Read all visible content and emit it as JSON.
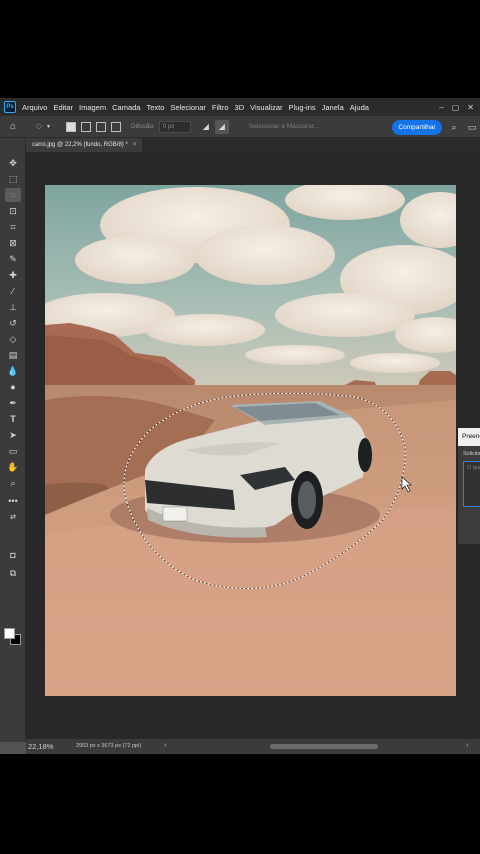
{
  "menubar": {
    "logo": "Ps",
    "items": [
      "Arquivo",
      "Editar",
      "Imagem",
      "Camada",
      "Texto",
      "Selecionar",
      "Filtro",
      "3D",
      "Visualizar",
      "Plug-ins",
      "Janela",
      "Ajuda"
    ]
  },
  "options": {
    "feather_label": "Difusão:",
    "feather_value": "0 px",
    "select_subject": "Selecionar e Mascarar...",
    "share_label": "Compartilhar"
  },
  "document": {
    "tab_title": "carro.jpg @ 22,2% (fundo, RGB/8) *",
    "close_glyph": "×"
  },
  "panel": {
    "title": "Preenchimento Generativo",
    "sub": "Solicitação",
    "placeholder": "O que deseja gerar? (Opcional)"
  },
  "status": {
    "zoom": "22,18%",
    "doc_size": "2953 px x 3673 px (72 ppi)",
    "arrow_glyph": "›"
  },
  "theme": {
    "accent": "#1473e6",
    "app_bg": "#535353",
    "bar_bg": "#3b3b3b"
  },
  "icons": {
    "tools": [
      "move-icon",
      "marquee-icon",
      "lasso-icon",
      "object-select-icon",
      "crop-icon",
      "frame-icon",
      "eyedropper-icon",
      "healing-brush-icon",
      "brush-icon",
      "clone-stamp-icon",
      "history-brush-icon",
      "eraser-icon",
      "gradient-icon",
      "blur-icon",
      "dodge-icon",
      "pen-icon",
      "type-icon",
      "path-select-icon",
      "rectangle-icon",
      "hand-icon",
      "zoom-icon",
      "more-tools-icon"
    ]
  }
}
